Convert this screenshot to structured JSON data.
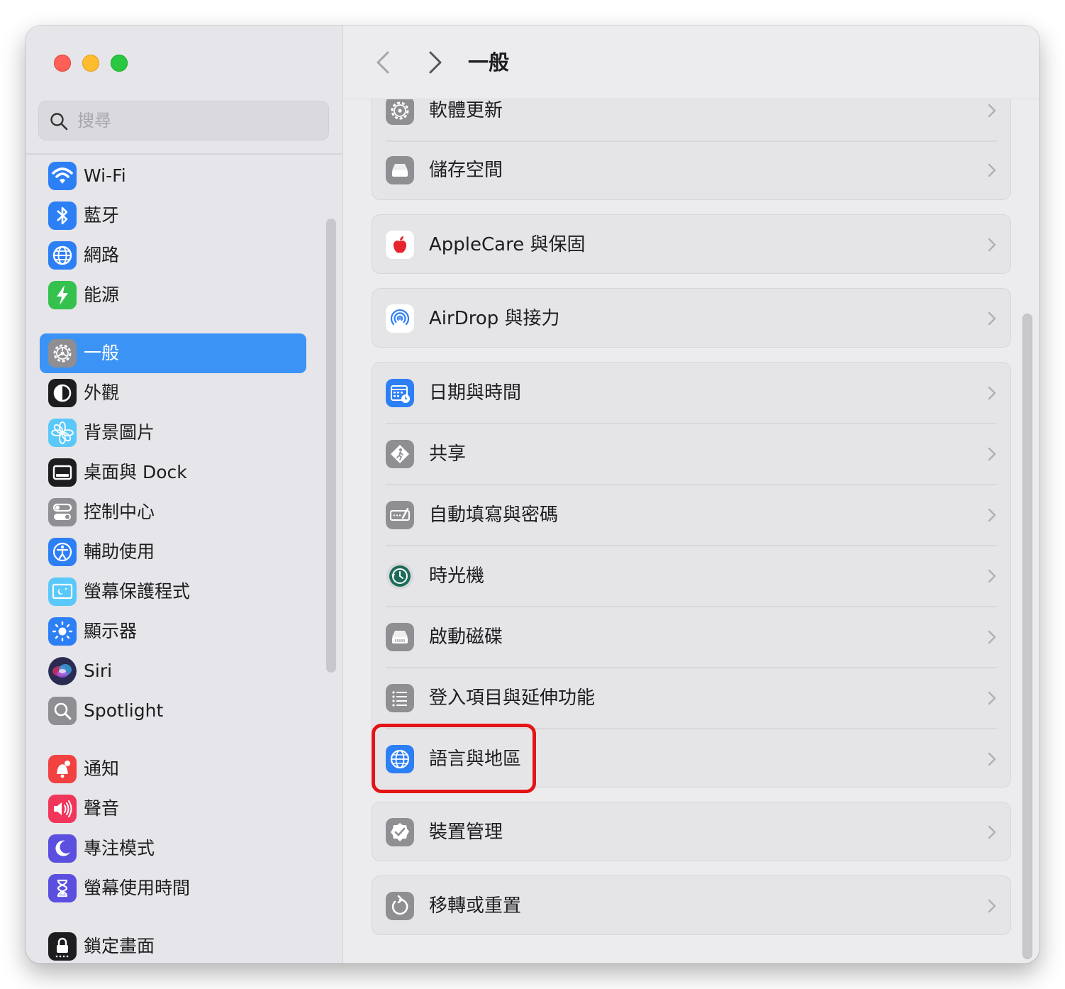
{
  "window": {
    "buttons": {
      "close": "close",
      "minimize": "minimize",
      "zoom": "zoom"
    }
  },
  "search": {
    "placeholder": "搜尋",
    "value": ""
  },
  "sidebar": {
    "items": [
      {
        "label": "Wi-Fi",
        "icon": "wifi-icon",
        "color": "#2d7ff6"
      },
      {
        "label": "藍牙",
        "icon": "bluetooth-icon",
        "color": "#2d7ff6"
      },
      {
        "label": "網路",
        "icon": "globe-network-icon",
        "color": "#2d7ff6"
      },
      {
        "label": "能源",
        "icon": "battery-bolt-icon",
        "color": "#35c14e"
      },
      {
        "label": "一般",
        "icon": "gear-icon",
        "color": "#8e8e93",
        "selected": true
      },
      {
        "label": "外觀",
        "icon": "appearance-icon",
        "color": "#1d1d1f"
      },
      {
        "label": "背景圖片",
        "icon": "flower-icon",
        "color": "#5ac8fa"
      },
      {
        "label": "桌面與 Dock",
        "icon": "dock-icon",
        "color": "#1d1d1f"
      },
      {
        "label": "控制中心",
        "icon": "toggles-icon",
        "color": "#8e8e93"
      },
      {
        "label": "輔助使用",
        "icon": "accessibility-icon",
        "color": "#2d7ff6"
      },
      {
        "label": "螢幕保護程式",
        "icon": "screensaver-icon",
        "color": "#5ac8fa"
      },
      {
        "label": "顯示器",
        "icon": "sun-icon",
        "color": "#2d7ff6"
      },
      {
        "label": "Siri",
        "icon": "siri-icon",
        "color": "#2b2b52"
      },
      {
        "label": "Spotlight",
        "icon": "magnifier-icon",
        "color": "#8e8e93"
      },
      {
        "label": "通知",
        "icon": "bell-icon",
        "color": "#f24141"
      },
      {
        "label": "聲音",
        "icon": "speaker-icon",
        "color": "#f2355b"
      },
      {
        "label": "專注模式",
        "icon": "moon-icon",
        "color": "#5b4fe0"
      },
      {
        "label": "螢幕使用時間",
        "icon": "hourglass-icon",
        "color": "#5b4fe0"
      },
      {
        "label": "鎖定畫面",
        "icon": "lock-icon",
        "color": "#1d1d1f"
      }
    ]
  },
  "toolbar": {
    "back": "back",
    "forward": "forward",
    "title": "一般"
  },
  "main": {
    "groups": [
      {
        "rows": [
          {
            "label": "軟體更新",
            "icon": "gear-badge-icon",
            "color": "#8e8e93"
          },
          {
            "label": "儲存空間",
            "icon": "drive-icon",
            "color": "#8e8e93"
          }
        ]
      },
      {
        "rows": [
          {
            "label": "AppleCare 與保固",
            "icon": "apple-logo-icon",
            "color": "#e8252e"
          }
        ]
      },
      {
        "rows": [
          {
            "label": "AirDrop 與接力",
            "icon": "airdrop-icon",
            "color": "#2d7ff6"
          }
        ]
      },
      {
        "rows": [
          {
            "label": "日期與時間",
            "icon": "calendar-clock-icon",
            "color": "#2d7ff6"
          },
          {
            "label": "共享",
            "icon": "sharing-icon",
            "color": "#8e8e93"
          },
          {
            "label": "自動填寫與密碼",
            "icon": "keyboard-key-icon",
            "color": "#8e8e93"
          },
          {
            "label": "時光機",
            "icon": "time-machine-icon",
            "color": "#1f6b5a"
          },
          {
            "label": "啟動磁碟",
            "icon": "startup-disk-icon",
            "color": "#8e8e93"
          },
          {
            "label": "登入項目與延伸功能",
            "icon": "list-icon",
            "color": "#8e8e93"
          },
          {
            "label": "語言與地區",
            "icon": "globe-icon",
            "color": "#2d7ff6",
            "highlighted": true
          }
        ]
      },
      {
        "rows": [
          {
            "label": "裝置管理",
            "icon": "checkmark-badge-icon",
            "color": "#8e8e93"
          }
        ]
      },
      {
        "rows": [
          {
            "label": "移轉或重置",
            "icon": "reset-arrow-icon",
            "color": "#8e8e93"
          }
        ]
      }
    ]
  },
  "colors": {
    "accent": "#3b93f5",
    "highlight": "#e41414"
  }
}
